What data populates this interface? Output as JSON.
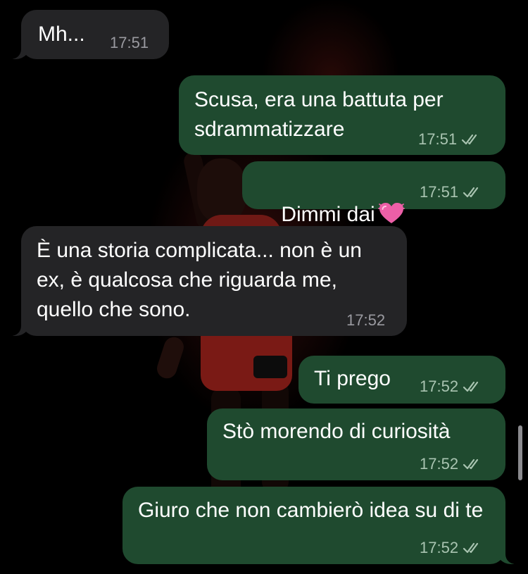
{
  "colors": {
    "incoming_bubble": "#242426",
    "outgoing_bubble": "#1f4a2f",
    "background": "#000000",
    "read_ticks": "#a9c4b1"
  },
  "messages": [
    {
      "direction": "incoming",
      "text": "Mh...",
      "time": "17:51"
    },
    {
      "direction": "outgoing",
      "text": "Scusa, era una battuta per sdrammatizzare",
      "time": "17:51",
      "status": "read"
    },
    {
      "direction": "outgoing",
      "text": "Dimmi dai",
      "emoji": "heart-emoji",
      "time": "17:51",
      "status": "read"
    },
    {
      "direction": "incoming",
      "text": "È una storia complicata... non è un ex, è qualcosa che riguarda me, quello che sono.",
      "time": "17:52"
    },
    {
      "direction": "outgoing",
      "text": "Ti prego",
      "time": "17:52",
      "status": "read"
    },
    {
      "direction": "outgoing",
      "text": "Stò morendo di curiosità",
      "time": "17:52",
      "status": "read"
    },
    {
      "direction": "outgoing",
      "text": "Giuro che non cambierò idea su di te",
      "time": "17:52",
      "status": "read"
    }
  ]
}
